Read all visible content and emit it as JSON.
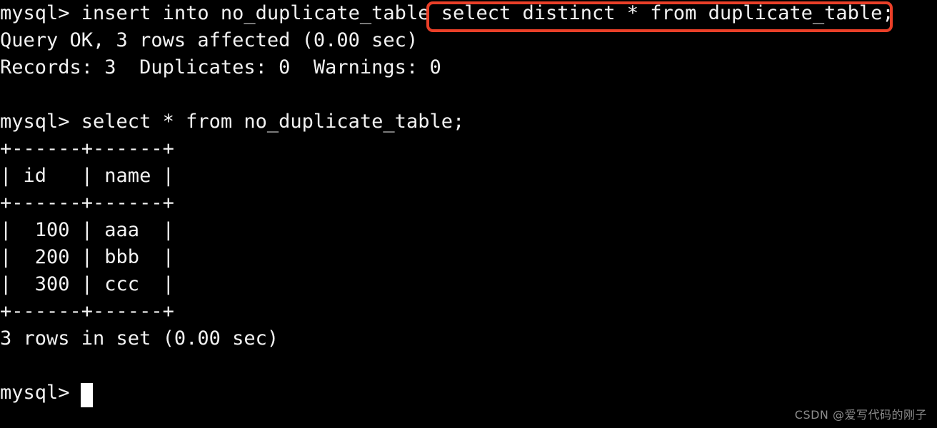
{
  "terminal": {
    "background_color": "#000000",
    "text_color": "#f2f2f2",
    "highlight_color": "#ea3f28",
    "cursor_color": "#ffffff",
    "lines": [
      {
        "id": "line-1",
        "text": "mysql> insert into no_duplicate_table select distinct * from duplicate_table;"
      },
      {
        "id": "line-2",
        "text": "Query OK, 3 rows affected (0.00 sec)"
      },
      {
        "id": "line-3",
        "text": "Records: 3  Duplicates: 0  Warnings: 0"
      },
      {
        "id": "line-4",
        "text": ""
      },
      {
        "id": "line-5",
        "text": "mysql> select * from no_duplicate_table;"
      },
      {
        "id": "line-6",
        "text": "+------+------+"
      },
      {
        "id": "line-7",
        "text": "| id   | name |"
      },
      {
        "id": "line-8",
        "text": "+------+------+"
      },
      {
        "id": "line-9",
        "text": "|  100 | aaa  |"
      },
      {
        "id": "line-10",
        "text": "|  200 | bbb  |"
      },
      {
        "id": "line-11",
        "text": "|  300 | ccc  |"
      },
      {
        "id": "line-12",
        "text": "+------+------+"
      },
      {
        "id": "line-13",
        "text": "3 rows in set (0.00 sec)"
      },
      {
        "id": "line-14",
        "text": ""
      },
      {
        "id": "line-15",
        "text": "mysql> "
      }
    ],
    "prompt": "mysql>",
    "highlighted_command": "select distinct * from duplicate_table;",
    "commands": [
      "insert into no_duplicate_table select distinct * from duplicate_table;",
      "select * from no_duplicate_table;"
    ],
    "status_messages": [
      "Query OK, 3 rows affected (0.00 sec)",
      "Records: 3  Duplicates: 0  Warnings: 0",
      "3 rows in set (0.00 sec)"
    ],
    "result_table": {
      "columns": [
        "id",
        "name"
      ],
      "rows": [
        [
          "100",
          "aaa"
        ],
        [
          "200",
          "bbb"
        ],
        [
          "300",
          "ccc"
        ]
      ],
      "row_count": "3",
      "separator": "+------+------+"
    }
  },
  "watermark": {
    "text": "CSDN @爱写代码的刚子"
  }
}
